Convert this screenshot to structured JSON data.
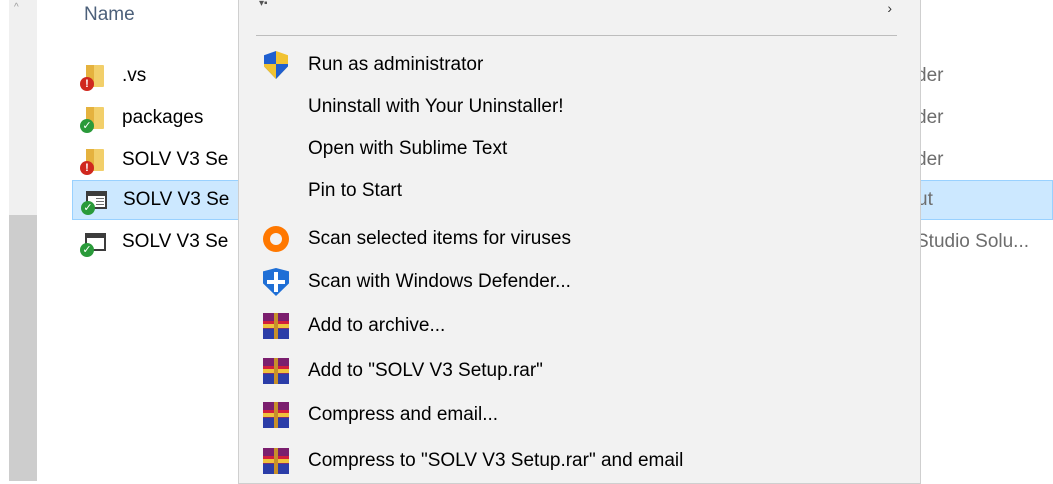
{
  "file_list": {
    "column_header": "Name",
    "rows": [
      {
        "name": ".vs",
        "icon": "folder-error-icon",
        "type_fragment": "der",
        "selected": false
      },
      {
        "name": "packages",
        "icon": "folder-sync-ok-icon",
        "type_fragment": "der",
        "selected": false
      },
      {
        "name": "SOLV V3 Se",
        "icon": "folder-error-icon",
        "type_fragment": "der",
        "selected": false
      },
      {
        "name": "SOLV V3 Se",
        "icon": "app-file-ok-icon",
        "type_fragment": "ut",
        "selected": true
      },
      {
        "name": "SOLV V3 Se",
        "icon": "window-file-ok-icon",
        "type_fragment": "Studio Solu...",
        "selected": false
      }
    ]
  },
  "context_menu": {
    "items": [
      {
        "label": "Run as administrator",
        "icon": "uac-shield-icon"
      },
      {
        "label": "Uninstall with Your Uninstaller!",
        "icon": ""
      },
      {
        "label": "Open with Sublime Text",
        "icon": ""
      },
      {
        "label": "Pin to Start",
        "icon": ""
      },
      {
        "label": "Scan selected items for viruses",
        "icon": "avast-icon"
      },
      {
        "label": "Scan with Windows Defender...",
        "icon": "windows-defender-icon"
      },
      {
        "label": "Add to archive...",
        "icon": "winrar-icon"
      },
      {
        "label": "Add to \"SOLV V3 Setup.rar\"",
        "icon": "winrar-icon"
      },
      {
        "label": "Compress and email...",
        "icon": "winrar-icon"
      },
      {
        "label": "Compress to \"SOLV V3 Setup.rar\" and email",
        "icon": "winrar-icon"
      }
    ]
  },
  "colors": {
    "selection_background": "#cce8ff",
    "selection_border": "#99d1ff",
    "menu_background": "#f2f2f2",
    "header_text": "#4c607a"
  }
}
